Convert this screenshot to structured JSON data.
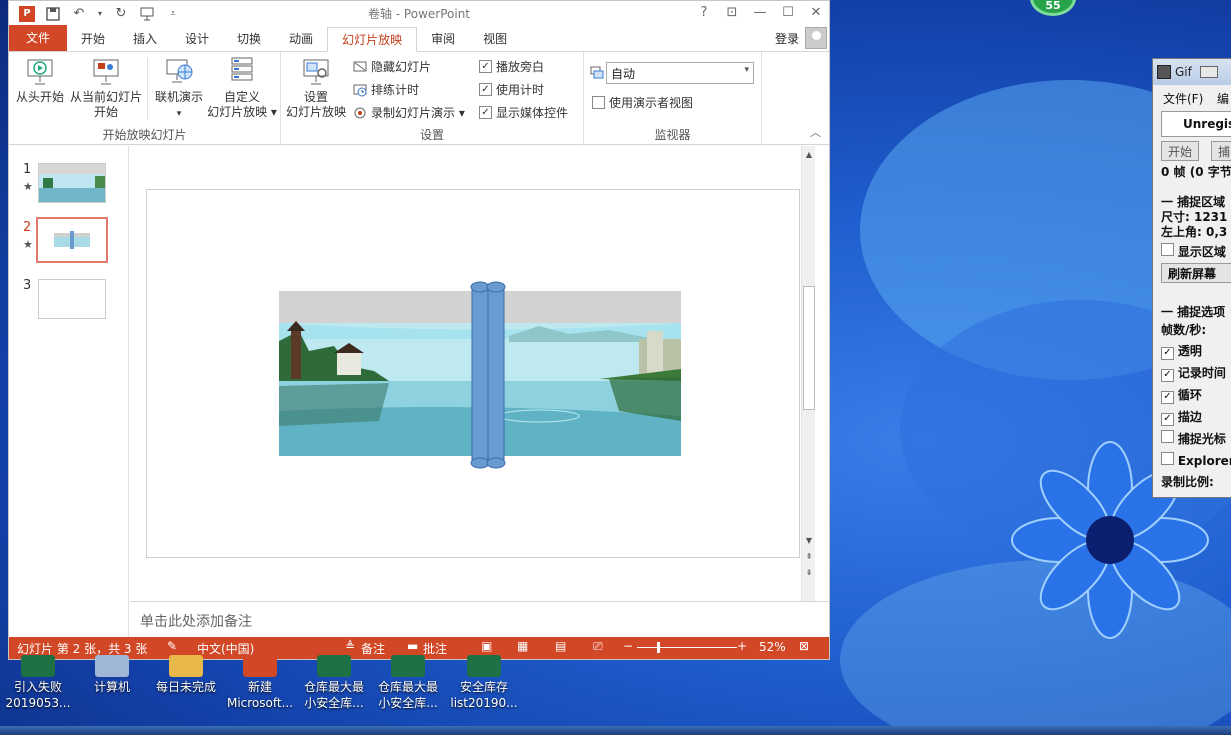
{
  "window": {
    "title": "卷轴 - PowerPoint",
    "app_letter": "P"
  },
  "tabs": [
    "文件",
    "开始",
    "插入",
    "设计",
    "切换",
    "动画",
    "幻灯片放映",
    "审阅",
    "视图"
  ],
  "account": {
    "login": "登录"
  },
  "ribbon": {
    "group1": {
      "label": "开始放映幻灯片",
      "from_start": "从头开始",
      "from_current_l1": "从当前幻灯片",
      "from_current_l2": "开始",
      "online_l1": "联机演示",
      "online_l2": "▾",
      "custom_l1": "自定义",
      "custom_l2": "幻灯片放映 ▾"
    },
    "group2": {
      "label": "设置",
      "setup_l1": "设置",
      "setup_l2": "幻灯片放映",
      "hide": "隐藏幻灯片",
      "rehearse": "排练计时",
      "record": "录制幻灯片演示 ▾",
      "narration": "播放旁白",
      "timings": "使用计时",
      "media": "显示媒体控件"
    },
    "group3": {
      "label": "监视器",
      "monitor_value": "自动",
      "presenter_view": "使用演示者视图"
    }
  },
  "slides": [
    {
      "num": "1",
      "star": "★"
    },
    {
      "num": "2",
      "star": "★"
    },
    {
      "num": "3",
      "star": ""
    }
  ],
  "notes_placeholder": "单击此处添加备注",
  "status": {
    "slide_info": "幻灯片 第 2 张，共 3 张",
    "language": "中文(中国)",
    "notes": "备注",
    "comments": "批注",
    "zoom": "52%",
    "minus": "−",
    "plus": "+"
  },
  "gif_window": {
    "title": "Gif",
    "menu_file": "文件(F)",
    "menu_edit": "编",
    "unregistered": "Unregist",
    "btn_start": "开始",
    "btn_capture": "捕",
    "frames": "0 帧 (0 字节",
    "capture_area": "一 捕捉区域",
    "size": "尺寸: 1231",
    "top_left": "左上角: 0,3",
    "show_area": "显示区域",
    "refresh": "刷新屏幕",
    "capture_opts": "一 捕捉选项",
    "fps": "帧数/秒:",
    "opt_transparent": "透明",
    "opt_record_time": "记录时间",
    "opt_loop": "循环",
    "opt_outline": "描边",
    "opt_cursor": "捕捉光标",
    "opt_explorer": "Explorer",
    "record_ratio": "录制比例:"
  },
  "desktop_icons": [
    {
      "l1": "引入失败",
      "l2": "2019053..."
    },
    {
      "l1": "计算机",
      "l2": ""
    },
    {
      "l1": "每日未完成",
      "l2": ""
    },
    {
      "l1": "新建",
      "l2": "Microsoft..."
    },
    {
      "l1": "仓库最大最",
      "l2": "小安全库..."
    },
    {
      "l1": "仓库最大最",
      "l2": "小安全库..."
    },
    {
      "l1": "安全库存",
      "l2": "list20190..."
    }
  ],
  "badge": "55",
  "colors": {
    "accent": "#d24726",
    "desktop": "#1f5fcf"
  }
}
